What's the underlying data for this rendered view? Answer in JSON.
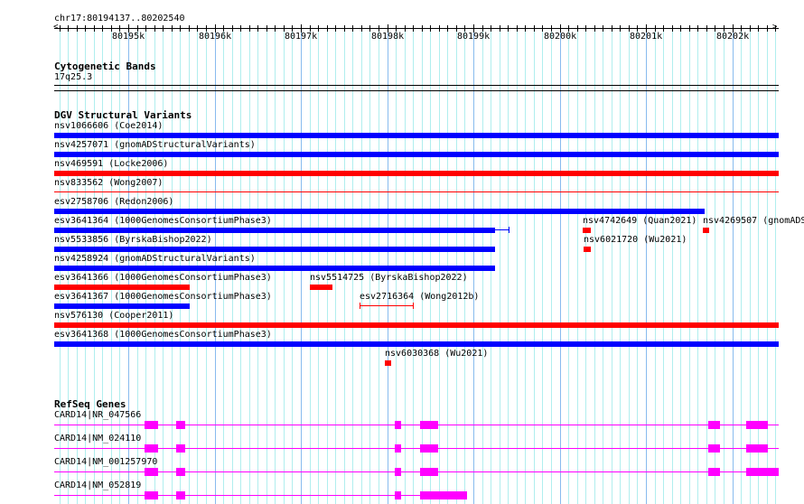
{
  "ruler": {
    "location": "chr17:80194137..80202540",
    "ticks": [
      "80195k",
      "80196k",
      "80197k",
      "80198k",
      "80199k",
      "80200k",
      "80201k",
      "80202k"
    ]
  },
  "cyto": {
    "title": "Cytogenetic Bands",
    "band": "17q25.3"
  },
  "dgv": {
    "title": "DGV Structural Variants",
    "features": [
      "nsv1066606 (Coe2014)",
      "nsv4257071 (gnomADStructuralVariants)",
      "nsv469591 (Locke2006)",
      "nsv833562 (Wong2007)",
      "esv2758706 (Redon2006)",
      "esv3641364 (1000GenomesConsortiumPhase3)",
      "nsv4742649 (Quan2021)",
      "nsv4269507 (gnomADS",
      "nsv5533856 (ByrskaBishop2022)",
      "nsv6021720 (Wu2021)",
      "nsv4258924 (gnomADStructuralVariants)",
      "esv3641366 (1000GenomesConsortiumPhase3)",
      "nsv5514725 (ByrskaBishop2022)",
      "esv3641367 (1000GenomesConsortiumPhase3)",
      "esv2716364 (Wong2012b)",
      "nsv576130 (Cooper2011)",
      "esv3641368 (1000GenomesConsortiumPhase3)",
      "nsv6030368 (Wu2021)"
    ]
  },
  "genes": {
    "title": "RefSeq Genes",
    "transcripts": [
      "CARD14|NR_047566",
      "CARD14|NM_024110",
      "CARD14|NM_001257970",
      "CARD14|NM_052819"
    ]
  },
  "colors": {
    "loss": "#ff0000",
    "gain": "#0000ff",
    "gene": "#ff00ff",
    "grid_minor": "#b0eeee",
    "grid_major": "#88bbee"
  }
}
